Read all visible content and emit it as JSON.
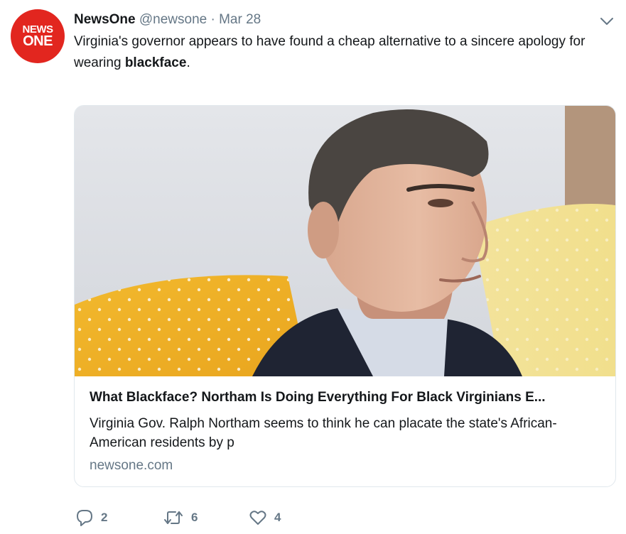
{
  "author": {
    "avatar_line1": "NEWS",
    "avatar_line2": "ONE",
    "name": "NewsOne",
    "handle": "@newsone",
    "separator": "·",
    "date": "Mar 28"
  },
  "tweet": {
    "text_before": "Virginia's governor appears to have found a cheap alternative to a sincere apology for wearing ",
    "text_bold": "blackface",
    "text_after": "."
  },
  "card": {
    "title": "What Blackface? Northam Is Doing Everything For Black Virginians E...",
    "description": "Virginia Gov. Ralph Northam seems to think he can placate the state's African-American residents by p",
    "domain": "newsone.com"
  },
  "actions": {
    "reply_count": "2",
    "retweet_count": "6",
    "like_count": "4"
  },
  "icons": {
    "caret": "chevron-down-icon",
    "reply": "reply-icon",
    "retweet": "retweet-icon",
    "like": "heart-icon"
  },
  "colors": {
    "brand_red": "#e2261f",
    "text": "#14171a",
    "muted": "#657786",
    "border": "#e1e8ed"
  }
}
